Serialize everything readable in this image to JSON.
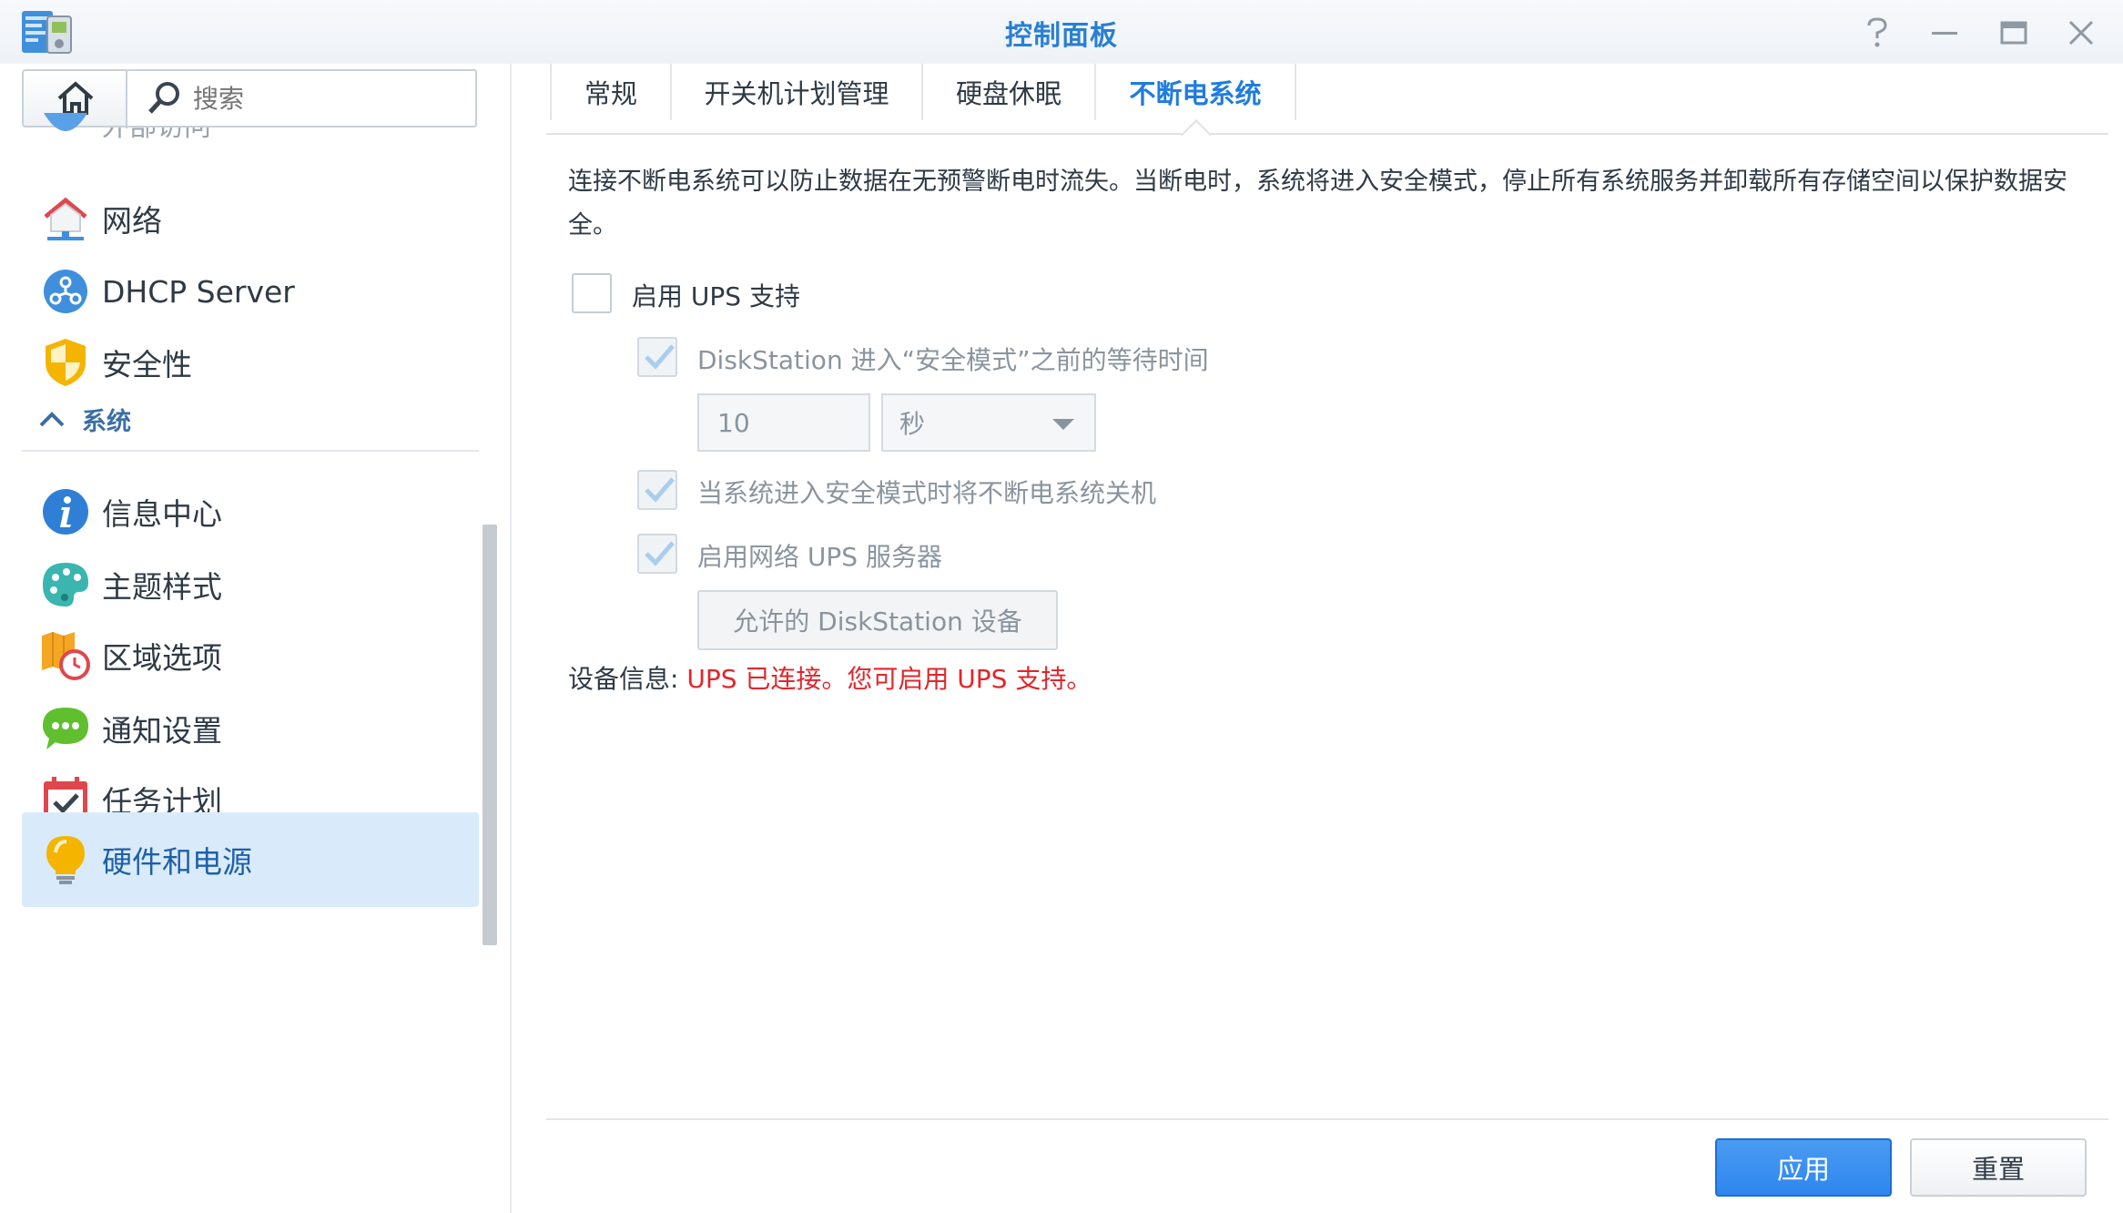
{
  "window": {
    "title": "控制面板",
    "controls": [
      "help-icon",
      "minimize-icon",
      "maximize-icon",
      "close-icon"
    ]
  },
  "sidebar": {
    "search_placeholder": "搜索",
    "partial_item_label": "外部访问",
    "items_top": [
      {
        "label": "网络",
        "icon": "network-house-icon"
      },
      {
        "label": "DHCP Server",
        "icon": "dhcp-icon"
      },
      {
        "label": "安全性",
        "icon": "shield-icon"
      }
    ],
    "section": {
      "label": "系统",
      "icon": "chevron-up-icon"
    },
    "items_system": [
      {
        "label": "信息中心",
        "icon": "info-icon"
      },
      {
        "label": "主题样式",
        "icon": "palette-icon"
      },
      {
        "label": "区域选项",
        "icon": "region-clock-icon"
      },
      {
        "label": "通知设置",
        "icon": "chat-bubble-icon"
      },
      {
        "label": "任务计划",
        "icon": "calendar-check-icon"
      },
      {
        "label": "硬件和电源",
        "icon": "lightbulb-icon",
        "active": true
      }
    ]
  },
  "tabs": [
    {
      "label": "常规"
    },
    {
      "label": "开关机计划管理"
    },
    {
      "label": "硬盘休眠"
    },
    {
      "label": "不断电系统",
      "active": true
    }
  ],
  "ups": {
    "description": "连接不断电系统可以防止数据在无预警断电时流失。当断电时，系统将进入安全模式，停止所有系统服务并卸载所有存储空间以保护数据安全。",
    "enable_label": "启用 UPS 支持",
    "enable_checked": false,
    "wait_label": "DiskStation 进入“安全模式”之前的等待时间",
    "wait_checked": true,
    "wait_value": "10",
    "wait_unit": "秒",
    "shutdown_label": "当系统进入安全模式时将不断电系统关机",
    "shutdown_checked": true,
    "network_label": "启用网络 UPS 服务器",
    "network_checked": true,
    "allowed_button": "允许的 DiskStation 设备",
    "device_info_label": "设备信息:",
    "device_info_message": "UPS 已连接。您可启用 UPS 支持。"
  },
  "footer": {
    "apply_label": "应用",
    "reset_label": "重置"
  },
  "colors": {
    "accent": "#1f7ce0",
    "warning_text": "#e0262b",
    "active_sidebar_bg": "#d9ebfb"
  }
}
